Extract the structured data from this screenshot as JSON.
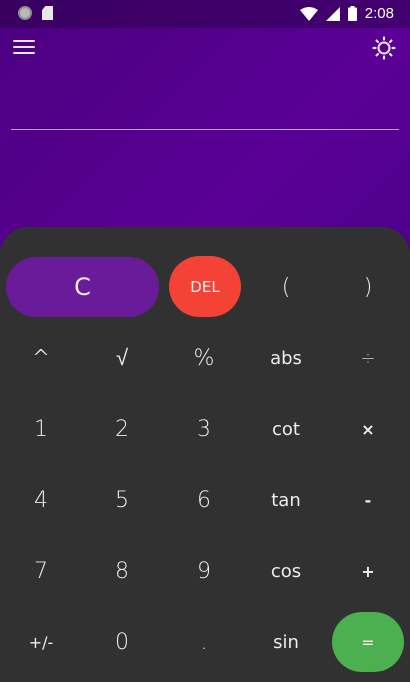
{
  "status_bar": {
    "time": "2:08"
  },
  "header": {
    "menu_icon": "menu-icon",
    "theme_icon": "brightness-icon"
  },
  "display": {
    "expression": ""
  },
  "keypad": {
    "row1": {
      "clear": "C",
      "delete": "DEL",
      "open_paren": "(",
      "close_paren": ")"
    },
    "row2": {
      "power": "^",
      "sqrt": "√",
      "percent": "%",
      "abs": "abs",
      "divide": "÷"
    },
    "row3": {
      "one": "1",
      "two": "2",
      "three": "3",
      "cot": "cot",
      "multiply": "×"
    },
    "row4": {
      "four": "4",
      "five": "5",
      "six": "6",
      "tan": "tan",
      "minus": "-"
    },
    "row5": {
      "seven": "7",
      "eight": "8",
      "nine": "9",
      "cos": "cos",
      "plus": "+"
    },
    "row6": {
      "sign": "+/-",
      "zero": "0",
      "decimal": ".",
      "sin": "sin",
      "equals": "="
    }
  },
  "colors": {
    "background": "#5a0096",
    "panel": "#313131",
    "clear": "#6a1b9a",
    "delete": "#f44336",
    "equals": "#4caf50"
  }
}
